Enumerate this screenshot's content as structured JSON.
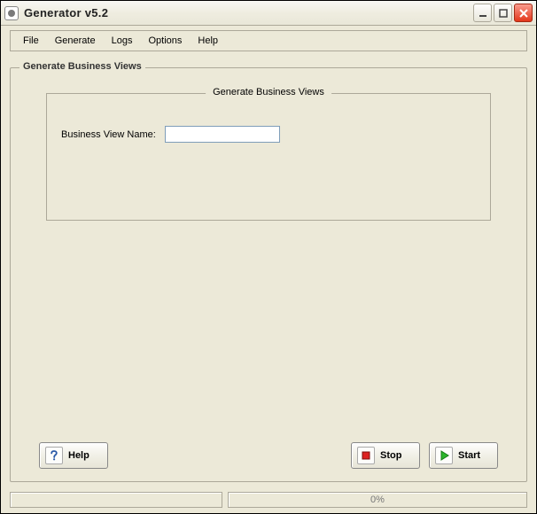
{
  "window": {
    "title": "Generator v5.2"
  },
  "menu": {
    "items": [
      "File",
      "Generate",
      "Logs",
      "Options",
      "Help"
    ]
  },
  "panel": {
    "outer_title": "Generate Business Views",
    "inner_title": "Generate Business Views",
    "field_label": "Business View Name:",
    "field_value": ""
  },
  "buttons": {
    "help": "Help",
    "stop": "Stop",
    "start": "Start"
  },
  "status": {
    "progress_text": "0%"
  }
}
